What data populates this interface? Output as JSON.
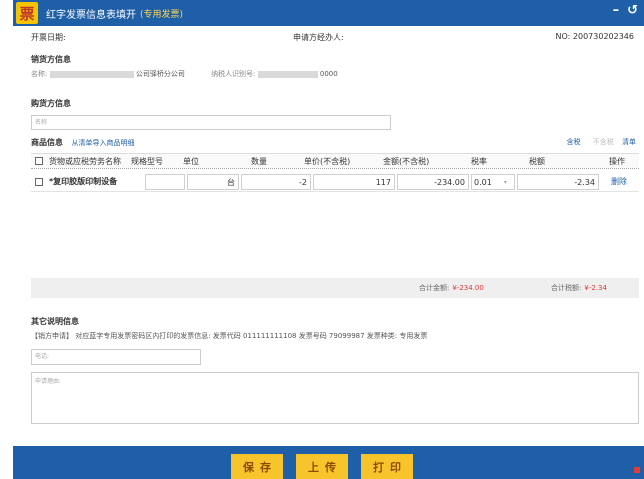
{
  "window": {
    "title": "红字发票信息表填开",
    "subtitle": "(专用发票)",
    "logo_char": "票",
    "minimize_glyph": "–",
    "back_glyph": "↺"
  },
  "top": {
    "date_label": "开票日期:",
    "applicant_label": "申请方经办人:",
    "number": "NO: 200730202346"
  },
  "seller": {
    "title": "销货方信息",
    "name_label": "名称:",
    "name_suffix": "公司驿桥分公司",
    "tax_id_label": "纳税人识别号:",
    "tax_id_suffix": "0000"
  },
  "buyer": {
    "title": "购货方信息",
    "name_placeholder": "名称"
  },
  "goods": {
    "title": "商品信息",
    "sub_link": "从清单导入商品明细",
    "actions": {
      "tax_inclusive": "含税",
      "tax_exclusive": "不含税",
      "list": "清单"
    },
    "columns": [
      "货物或应税劳务名称",
      "规格型号",
      "单位",
      "数量",
      "单价(不含税)",
      "金额(不含税)",
      "税率",
      "税额",
      "操作"
    ],
    "rows": [
      {
        "name": "*复印胶版印制设备",
        "spec": "",
        "unit": "台",
        "qty": "-2",
        "price": "117",
        "amount": "-234.00",
        "rate": "0.01",
        "tax": "-2.34",
        "op": "删除"
      }
    ]
  },
  "totals": {
    "amount_label": "合计金额:",
    "amount_value": "¥-234.00",
    "tax_label": "合计税额:",
    "tax_value": "¥-2.34"
  },
  "other": {
    "title": "其它说明信息",
    "text": "【销方申请】 对应蓝字专用发票密码区内打印的发票信息: 发票代码 011111111108 发票号码 79099987 发票种类: 专用发票",
    "phone_placeholder": "电话:",
    "reason_placeholder": "申请理由:"
  },
  "footer": {
    "save": "保存",
    "upload": "上传",
    "print": "打印"
  },
  "colors": {
    "title_bar": "#1f5fa8",
    "button": "#f7c52b",
    "accent_red": "#e23b3b"
  }
}
